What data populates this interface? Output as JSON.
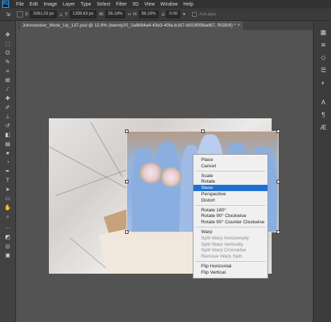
{
  "menubar": {
    "logo": "Ps",
    "items": [
      "File",
      "Edit",
      "Image",
      "Layer",
      "Type",
      "Select",
      "Filter",
      "3D",
      "View",
      "Window",
      "Help"
    ]
  },
  "options": {
    "x_label": "X:",
    "x_value": "3281.03 px",
    "y_label": "Y:",
    "y_value": "1359.63 px",
    "w_label": "W:",
    "w_value": "56.19%",
    "h_label": "H:",
    "h_value": "56.19%",
    "angle_value": "0.00",
    "antialias_label": "Anti-alias"
  },
  "document_tab": {
    "title": "Johnstocker_Mock_Up_137.psd @ 12.8% (twenty20_2a8694a4-43e3-40fa-b167-b503f098ad67, RGB/8) *",
    "close": "×"
  },
  "tools": [
    {
      "name": "move-tool-icon",
      "glyph": "✥"
    },
    {
      "name": "marquee-tool-icon",
      "glyph": "⬚"
    },
    {
      "name": "lasso-tool-icon",
      "glyph": "ʘ"
    },
    {
      "name": "quick-select-tool-icon",
      "glyph": "✎"
    },
    {
      "name": "crop-tool-icon",
      "glyph": "⌗"
    },
    {
      "name": "frame-tool-icon",
      "glyph": "⊠"
    },
    {
      "name": "eyedropper-tool-icon",
      "glyph": "⁄"
    },
    {
      "name": "healing-tool-icon",
      "glyph": "✚"
    },
    {
      "name": "brush-tool-icon",
      "glyph": "✐"
    },
    {
      "name": "stamp-tool-icon",
      "glyph": "⊥"
    },
    {
      "name": "history-brush-icon",
      "glyph": "↺"
    },
    {
      "name": "eraser-tool-icon",
      "glyph": "◧"
    },
    {
      "name": "gradient-tool-icon",
      "glyph": "▤"
    },
    {
      "name": "blur-tool-icon",
      "glyph": "●"
    },
    {
      "name": "dodge-tool-icon",
      "glyph": "◔"
    },
    {
      "name": "pen-tool-icon",
      "glyph": "✒"
    },
    {
      "name": "type-tool-icon",
      "glyph": "T"
    },
    {
      "name": "path-select-tool-icon",
      "glyph": "➤"
    },
    {
      "name": "shape-tool-icon",
      "glyph": "▭"
    },
    {
      "name": "hand-tool-icon",
      "glyph": "✋"
    },
    {
      "name": "zoom-tool-icon",
      "glyph": "⌕"
    },
    {
      "name": "more-tools-icon",
      "glyph": "···"
    },
    {
      "name": "color-swatches-icon",
      "glyph": "◩"
    },
    {
      "name": "quick-mask-icon",
      "glyph": "◎"
    },
    {
      "name": "screen-mode-icon",
      "glyph": "▣"
    }
  ],
  "right_tools": [
    {
      "name": "layers-panel-icon",
      "glyph": "▦"
    },
    {
      "name": "channels-panel-icon",
      "glyph": "≋"
    },
    {
      "name": "paths-panel-icon",
      "glyph": "◇"
    },
    {
      "name": "properties-panel-icon",
      "glyph": "☰"
    },
    {
      "name": "adjustments-panel-icon",
      "glyph": "◐"
    },
    {
      "name": "character-panel-icon",
      "glyph": "A"
    },
    {
      "name": "paragraph-panel-icon",
      "glyph": "¶"
    },
    {
      "name": "glyphs-panel-icon",
      "glyph": "Ӕ"
    }
  ],
  "context_menu": {
    "groups": [
      [
        {
          "label": "Place",
          "disabled": false
        },
        {
          "label": "Cancel",
          "disabled": false
        }
      ],
      [
        {
          "label": "Scale",
          "disabled": false
        },
        {
          "label": "Rotate",
          "disabled": false
        },
        {
          "label": "Skew",
          "disabled": false,
          "selected": true
        },
        {
          "label": "Perspective",
          "disabled": false
        },
        {
          "label": "Distort",
          "disabled": false
        }
      ],
      [
        {
          "label": "Rotate 180°",
          "disabled": false
        },
        {
          "label": "Rotate 90° Clockwise",
          "disabled": false
        },
        {
          "label": "Rotate 90° Counter Clockwise",
          "disabled": false
        }
      ],
      [
        {
          "label": "Warp",
          "disabled": false
        },
        {
          "label": "Split Warp Horizontally",
          "disabled": true
        },
        {
          "label": "Split Warp Vertically",
          "disabled": true
        },
        {
          "label": "Split Warp Crosswise",
          "disabled": true
        },
        {
          "label": "Remove Warp Split",
          "disabled": true
        }
      ],
      [
        {
          "label": "Flip Horizontal",
          "disabled": false
        },
        {
          "label": "Flip Vertical",
          "disabled": false
        }
      ]
    ]
  },
  "colors": {
    "accent": "#1e6fd0",
    "panel": "#424242",
    "canvas": "#535353"
  }
}
